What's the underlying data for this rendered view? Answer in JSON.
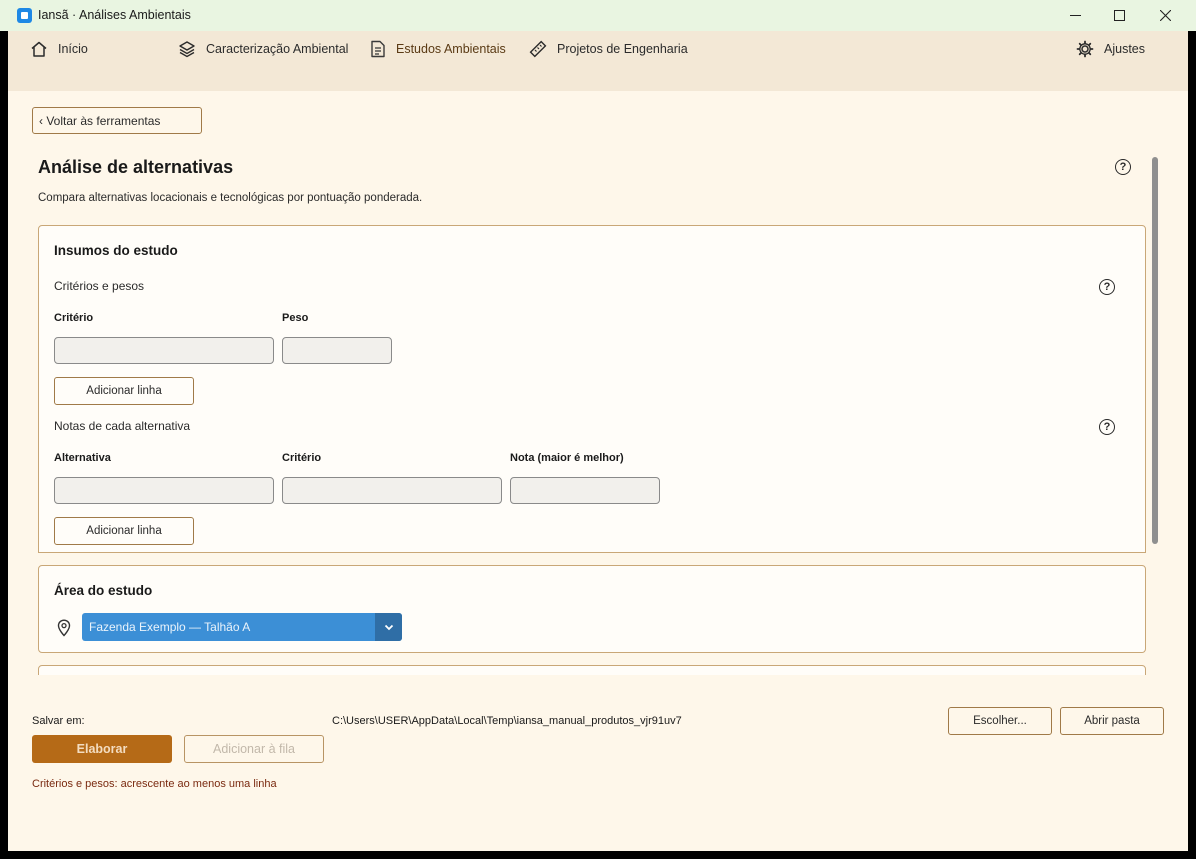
{
  "window": {
    "title": "Iansã · Análises Ambientais"
  },
  "nav": {
    "home": "Início",
    "caracterizacao": "Caracterização Ambiental",
    "estudos": "Estudos Ambientais",
    "projetos": "Projetos de Engenharia",
    "ajustes": "Ajustes"
  },
  "back_button": "‹ Voltar às ferramentas",
  "page": {
    "title": "Análise de alternativas",
    "description": "Compara alternativas locacionais e tecnológicas por pontuação ponderada.",
    "help": "?"
  },
  "insumos": {
    "title": "Insumos do estudo",
    "criterios": {
      "label": "Critérios e pesos",
      "columns": [
        "Critério",
        "Peso"
      ],
      "add_button": "Adicionar linha"
    },
    "notas": {
      "label": "Notas de cada alternativa",
      "columns": [
        "Alternativa",
        "Critério",
        "Nota (maior é melhor)"
      ],
      "add_button": "Adicionar linha"
    }
  },
  "area": {
    "title": "Área do estudo",
    "selected": "Fazenda Exemplo — Talhão A"
  },
  "footer": {
    "save_label": "Salvar em:",
    "save_path": "C:\\Users\\USER\\AppData\\Local\\Temp\\iansa_manual_produtos_vjr91uv7",
    "choose_button": "Escolher...",
    "open_button": "Abrir pasta",
    "elaborar_button": "Elaborar",
    "fila_button": "Adicionar à fila",
    "warning": "Critérios e pesos: acrescente ao menos uma linha"
  },
  "colors": {
    "accent": "#b56a17",
    "select": "#3c8fd6",
    "background": "#fef7ea",
    "navbar": "#f3e8d6",
    "warning": "#7a2a10"
  }
}
